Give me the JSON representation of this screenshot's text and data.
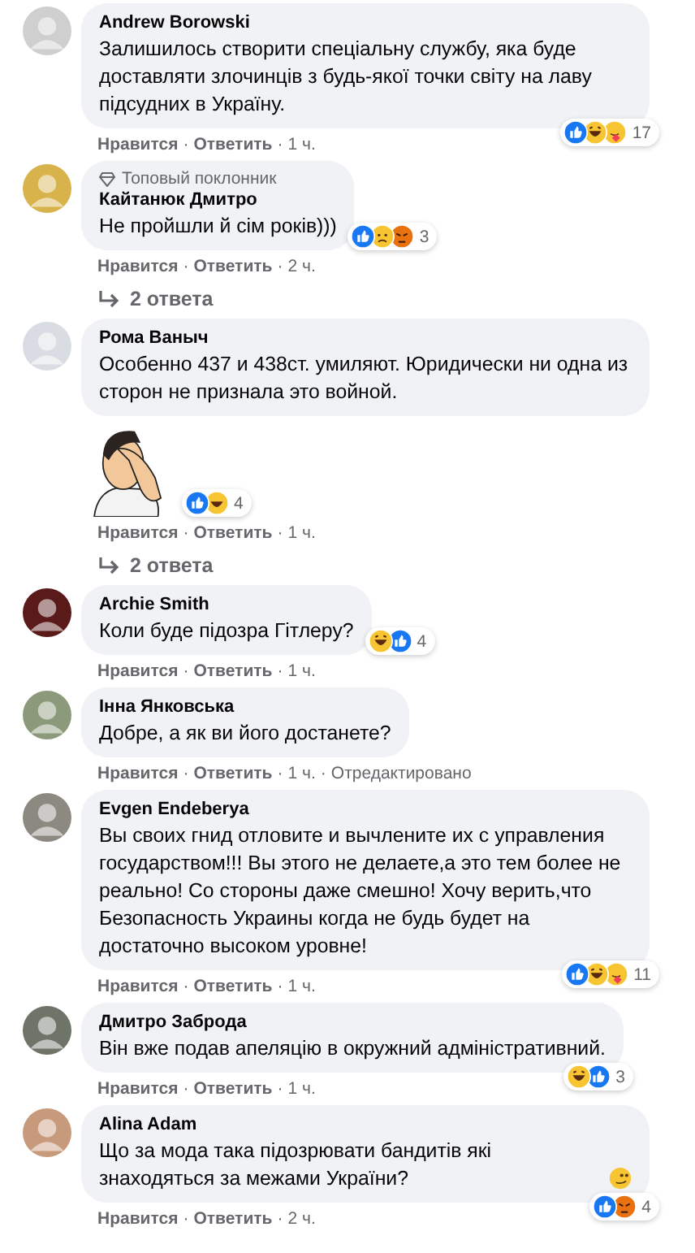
{
  "separator": "·",
  "comments": [
    {
      "author": "Andrew Borowski",
      "text": "Залишилось створити спеціальну службу, яка буде доставляти злочинців з будь-якої точки світу на лаву підсудних в Україну.",
      "reactions": [
        {
          "kind": "like"
        },
        {
          "kind": "haha"
        },
        {
          "kind": "care"
        }
      ],
      "reaction_count": "17",
      "actions": [
        "Нравится",
        "Ответить"
      ],
      "time": "1 ч."
    },
    {
      "author": "Кайтанюк Дмитро",
      "fan_badge": "Топовый поклонник",
      "text": "Не пройшли й сім років)))",
      "reactions": [
        {
          "kind": "like"
        },
        {
          "kind": "sad"
        },
        {
          "kind": "angry"
        }
      ],
      "reaction_count": "3",
      "actions": [
        "Нравится",
        "Ответить"
      ],
      "time": "2 ч.",
      "replies": "2 ответа"
    },
    {
      "author": "Рома Ваныч",
      "text": "Особенно 437 и 438ст. умиляют. Юридически ни одна из сторон не признала это войной.",
      "sticker": true,
      "reactions": [
        {
          "kind": "like"
        },
        {
          "kind": "haha"
        }
      ],
      "reaction_count": "4",
      "actions": [
        "Нравится",
        "Ответить"
      ],
      "time": "1 ч.",
      "replies": "2 ответа"
    },
    {
      "author": "Archie Smith",
      "text": "Коли буде підозра Гітлеру?",
      "reactions": [
        {
          "kind": "haha"
        },
        {
          "kind": "like"
        }
      ],
      "reaction_count": "4",
      "actions": [
        "Нравится",
        "Ответить"
      ],
      "time": "1 ч."
    },
    {
      "author": "Інна Янковська",
      "text": "Добре, а як ви його достанете?",
      "actions": [
        "Нравится",
        "Ответить"
      ],
      "time": "1 ч.",
      "edited": "Отредактировано"
    },
    {
      "author": "Evgen Endeberya",
      "text": "Вы своих гнид отловите и вычлените их с управления государством!!! Вы этого не делаете,а это тем более не реально! Со стороны даже смешно! Хочу верить,что Безопасность Украины когда не будь будет на достаточно высоком уровне!",
      "reactions": [
        {
          "kind": "like"
        },
        {
          "kind": "haha"
        },
        {
          "kind": "care"
        }
      ],
      "reaction_count": "11",
      "actions": [
        "Нравится",
        "Ответить"
      ],
      "time": "1 ч."
    },
    {
      "author": "Дмитро Заброда",
      "text": "Він вже подав апеляцію в окружний адміністративний.",
      "reactions": [
        {
          "kind": "haha"
        },
        {
          "kind": "like"
        }
      ],
      "reaction_count": "3",
      "actions": [
        "Нравится",
        "Ответить"
      ],
      "time": "1 ч."
    },
    {
      "author": "Alina Adam",
      "text": "Що за мода така підозрювати бандитів які знаходяться за межами України?",
      "trailing_emoji": true,
      "reactions": [
        {
          "kind": "like"
        },
        {
          "kind": "angry"
        }
      ],
      "reaction_count": "4",
      "actions": [
        "Нравится",
        "Ответить"
      ],
      "time": "2 ч."
    }
  ]
}
